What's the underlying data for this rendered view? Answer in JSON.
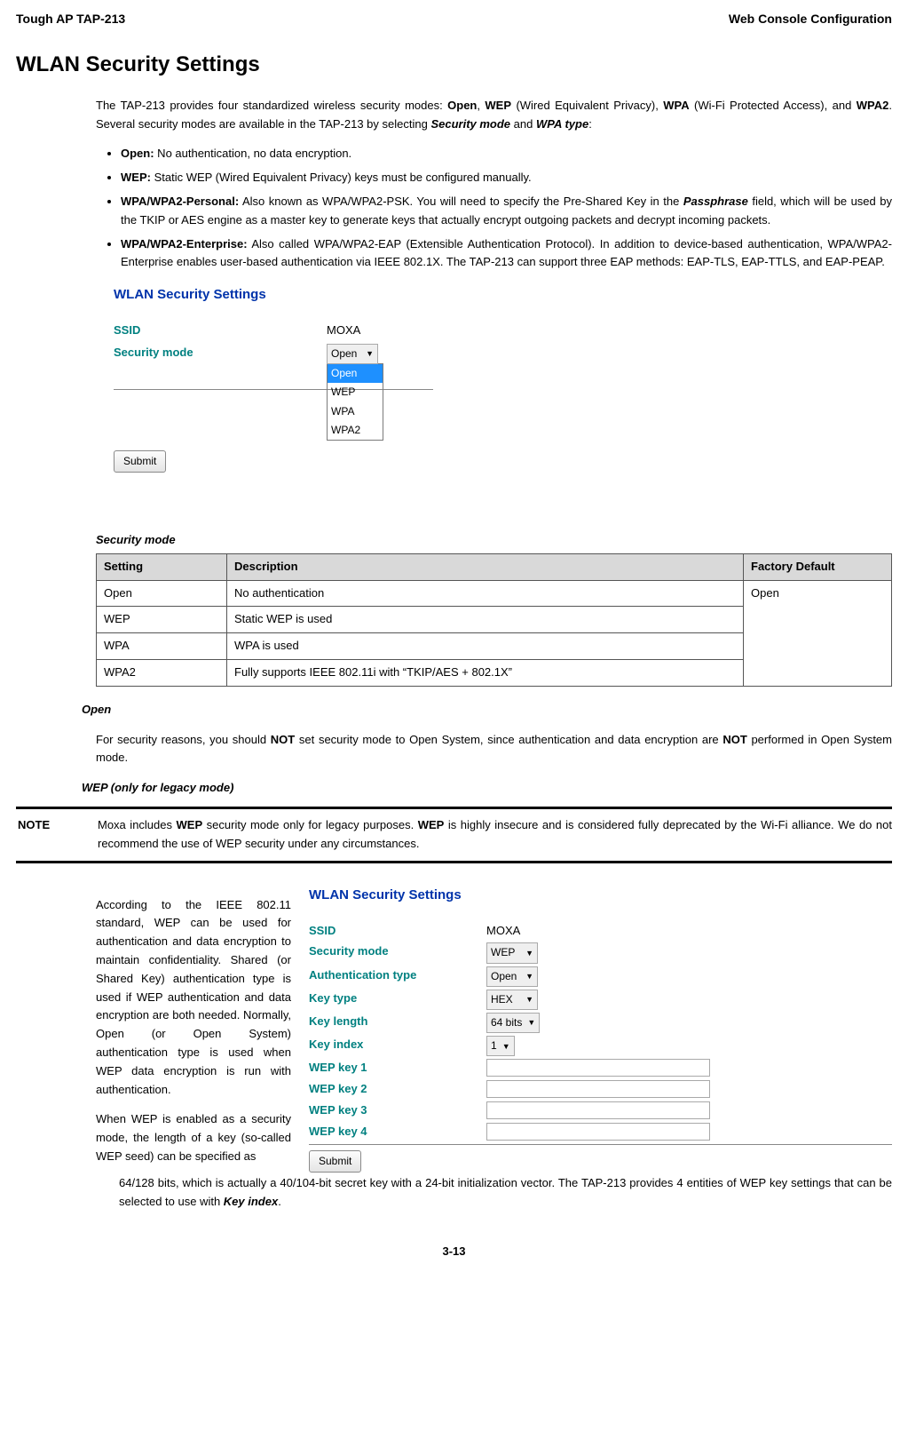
{
  "header": {
    "left": "Tough AP TAP-213",
    "right": "Web Console Configuration"
  },
  "title": "WLAN Security Settings",
  "intro": {
    "p1a": "The TAP-213 provides four standardized wireless security modes: ",
    "b1": "Open",
    "c1": ", ",
    "b2": "WEP",
    "p1b": " (Wired Equivalent Privacy), ",
    "b3": "WPA",
    "p1c": " (Wi-Fi Protected Access), and ",
    "b4": "WPA2",
    "p1d": ". Several security modes are available in the TAP-213 by selecting ",
    "bi1": "Security mode",
    "p1e": " and ",
    "bi2": "WPA type",
    "p1f": ":"
  },
  "bullets": {
    "li1b": "Open:",
    "li1": " No authentication, no data encryption.",
    "li2b": "WEP:",
    "li2": " Static WEP (Wired Equivalent Privacy) keys must be configured manually.",
    "li3b": "WPA/WPA2-Personal:",
    "li3a": " Also known as WPA/WPA2-PSK. You will need to specify the Pre-Shared Key in the ",
    "li3bi": "Passphrase",
    "li3c": " field, which will be used by the TKIP or AES engine as a master key to generate keys that actually encrypt outgoing packets and decrypt incoming packets.",
    "li4b": "WPA/WPA2-Enterprise:",
    "li4": " Also called WPA/WPA2-EAP (Extensible Authentication Protocol). In addition to device-based authentication, WPA/WPA2-Enterprise enables user-based authentication via IEEE 802.1X. The TAP-213 can support three EAP methods: EAP-TLS, EAP-TTLS, and EAP-PEAP."
  },
  "shot1": {
    "title": "WLAN Security Settings",
    "ssid_lbl": "SSID",
    "ssid_val": "MOXA",
    "mode_lbl": "Security mode",
    "mode_val": "Open",
    "options": [
      "Open",
      "WEP",
      "WPA",
      "WPA2"
    ],
    "submit": "Submit"
  },
  "table": {
    "caption": "Security mode",
    "h1": "Setting",
    "h2": "Description",
    "h3": "Factory Default",
    "r1c1": "Open",
    "r1c2": "No authentication",
    "default": "Open",
    "r2c1": "WEP",
    "r2c2": "Static WEP is used",
    "r3c1": "WPA",
    "r3c2": "WPA is used",
    "r4c1": "WPA2",
    "r4c2": "Fully supports IEEE 802.11i with “TKIP/AES + 802.1X”"
  },
  "open": {
    "h": "Open",
    "a": "For security reasons, you should ",
    "b1": "NOT",
    "b": " set security mode to Open System, since authentication and data encryption are ",
    "b2": "NOT",
    "c": " performed in Open System mode."
  },
  "wephead": "WEP (only for legacy mode)",
  "note": {
    "label": "NOTE",
    "a": "Moxa includes ",
    "b1": "WEP",
    "b": " security mode only for legacy purposes. ",
    "b2": "WEP",
    "c": " is highly insecure and is considered fully deprecated by the Wi-Fi alliance. We do not recommend the use of WEP security under any circumstances."
  },
  "wep": {
    "p1": "According to the IEEE 802.11 standard, WEP can be used for authentication and data encryption to maintain confidentiality. Shared (or Shared Key) authentication type is used if WEP authentication and data encryption are both needed. Normally, Open (or Open System) authentication type is used when WEP data encryption is run with authentication.",
    "p2": "When WEP is enabled as a security mode, the length of a key (so-called WEP seed) can be specified as",
    "p3a": "64/128 bits, which is actually a 40/104-bit secret key with a 24-bit initialization vector. The TAP-213 provides 4 entities of WEP key settings that can be selected to use with ",
    "p3bi": "Key index",
    "p3b": "."
  },
  "shot2": {
    "title": "WLAN Security Settings",
    "ssid_lbl": "SSID",
    "ssid_val": "MOXA",
    "mode_lbl": "Security mode",
    "mode_val": "WEP",
    "auth_lbl": "Authentication type",
    "auth_val": "Open",
    "ktype_lbl": "Key type",
    "ktype_val": "HEX",
    "klen_lbl": "Key length",
    "klen_val": "64 bits",
    "kidx_lbl": "Key index",
    "kidx_val": "1",
    "k1": "WEP key 1",
    "k2": "WEP key 2",
    "k3": "WEP key 3",
    "k4": "WEP key 4",
    "submit": "Submit"
  },
  "pagenum": "3-13"
}
